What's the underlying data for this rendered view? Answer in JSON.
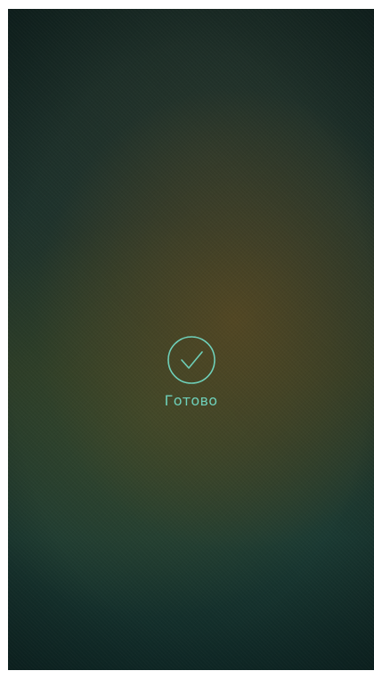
{
  "status": {
    "done_label": "Готово",
    "icon": "check-circle-icon",
    "accent_color": "#6fd2bb"
  }
}
